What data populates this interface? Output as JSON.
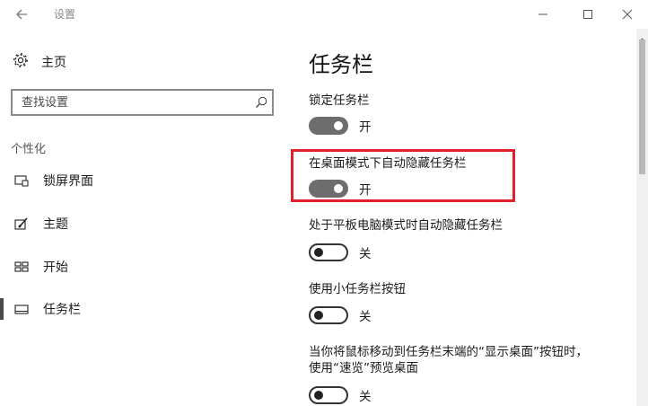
{
  "window": {
    "title": "设置"
  },
  "sidebar": {
    "home_label": "主页",
    "search_placeholder": "查找设置",
    "section_label": "个性化",
    "items": [
      {
        "label": "锁屏界面",
        "icon": "lock-screen-icon"
      },
      {
        "label": "主题",
        "icon": "theme-icon"
      },
      {
        "label": "开始",
        "icon": "start-icon"
      },
      {
        "label": "任务栏",
        "icon": "taskbar-icon",
        "active": true
      }
    ]
  },
  "main": {
    "title": "任务栏",
    "settings": [
      {
        "label": "锁定任务栏",
        "state": "开"
      },
      {
        "label": "在桌面模式下自动隐藏任务栏",
        "state": "开"
      },
      {
        "label": "处于平板电脑模式时自动隐藏任务栏",
        "state": "关"
      },
      {
        "label": "使用小任务栏按钮",
        "state": "关"
      },
      {
        "label_line1": "当你将鼠标移动到任务栏末端的“显示桌面”按钮时，",
        "label_line2": "使用“速览”预览桌面",
        "state": "关"
      }
    ]
  },
  "colors": {
    "highlight": "#e0202a",
    "toggle_on": "#6d6d6d",
    "accent_bar": "#4a4a4a"
  }
}
